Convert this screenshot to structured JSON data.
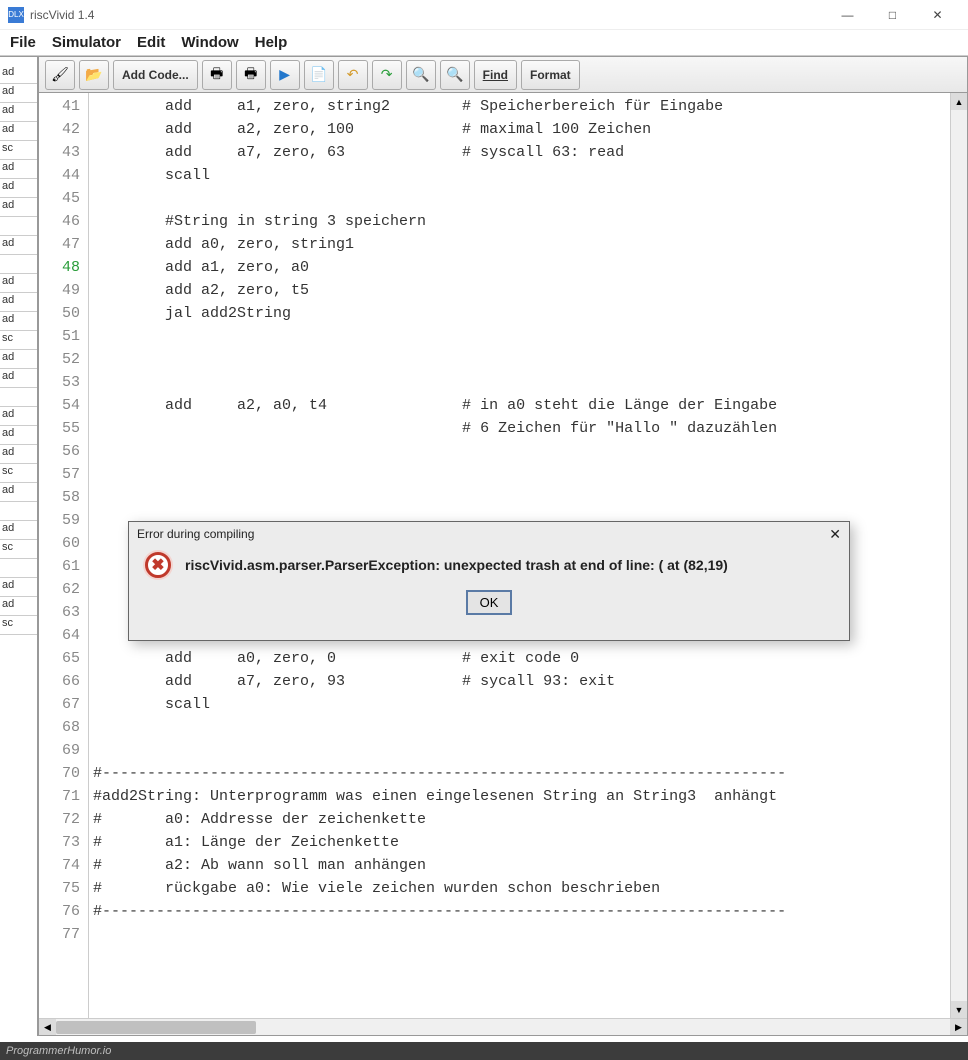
{
  "window": {
    "title": "riscVivid 1.4",
    "app_icon_label": "DLX",
    "min_icon": "—",
    "max_icon": "□",
    "close_icon": "✕"
  },
  "menubar": [
    "File",
    "Simulator",
    "Edit",
    "Window",
    "Help"
  ],
  "toolbar": {
    "brush_icon": "🖌",
    "open_icon": "📂",
    "add_code_label": "Add Code...",
    "print_icon": "🖶",
    "print2_icon": "🖶",
    "run_icon": "▶",
    "copy_icon": "📄",
    "undo_icon": "↶",
    "redo_icon": "↷",
    "zoom_icon": "🔍",
    "zoom2_icon": "🔍",
    "find_label": "Find",
    "format_label": "Format"
  },
  "side_cuts": [
    "ad",
    "ad",
    "ad",
    "ad",
    "sc",
    "ad",
    "ad",
    "ad",
    "",
    "ad",
    "",
    "ad",
    "ad",
    "ad",
    "sc",
    "ad",
    "ad",
    "",
    "ad",
    "ad",
    "ad",
    "sc",
    "ad",
    "",
    "ad",
    "sc",
    "",
    "ad",
    "ad",
    "sc"
  ],
  "gutter": {
    "start": 41,
    "end": 77,
    "current": 48
  },
  "code_lines": [
    "        add     a1, zero, string2        # Speicherbereich für Eingabe",
    "        add     a2, zero, 100            # maximal 100 Zeichen",
    "        add     a7, zero, 63             # syscall 63: read",
    "        scall",
    "",
    "        #String in string 3 speichern",
    "        add a0, zero, string1",
    "        add a1, zero, a0",
    "        add a2, zero, t5",
    "        jal add2String",
    "",
    "",
    "",
    "        add     a2, a0, t4               # in a0 steht die Länge der Eingabe",
    "                                         # 6 Zeichen für \"Hallo \" dazuzählen",
    "",
    "",
    "",
    "",
    "",
    "",
    "",
    "",
    "",
    "        add     a0, zero, 0              # exit code 0",
    "        add     a7, zero, 93             # sycall 93: exit",
    "        scall",
    "",
    "",
    "#----------------------------------------------------------------------------",
    "#add2String: Unterprogramm was einen eingelesenen String an String3  anhängt",
    "#       a0: Addresse der zeichenkette",
    "#       a1: Länge der Zeichenkette",
    "#       a2: Ab wann soll man anhängen",
    "#       rückgabe a0: Wie viele zeichen wurden schon beschrieben",
    "#----------------------------------------------------------------------------",
    ""
  ],
  "dialog": {
    "title": "Error during compiling",
    "message": "riscVivid.asm.parser.ParserException: unexpected trash at end of line: ( at (82,19)",
    "ok_label": "OK",
    "error_glyph": "✖"
  },
  "footer": "ProgrammerHumor.io"
}
